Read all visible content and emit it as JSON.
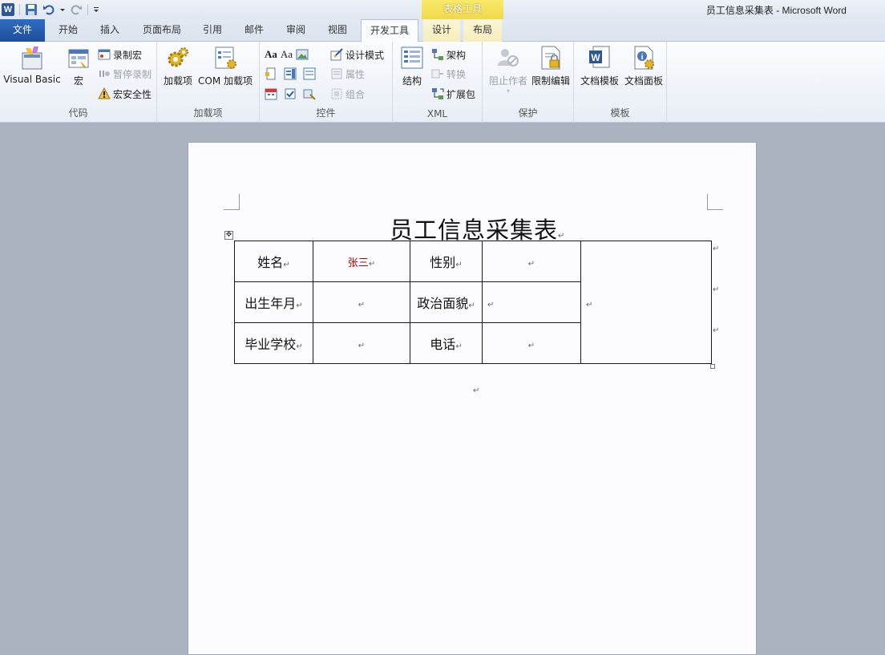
{
  "window": {
    "title": "员工信息采集表 - Microsoft Word",
    "context_tab_group": "表格工具",
    "app_icon_letter": "W"
  },
  "tabs": [
    {
      "label": "文件"
    },
    {
      "label": "开始"
    },
    {
      "label": "插入"
    },
    {
      "label": "页面布局"
    },
    {
      "label": "引用"
    },
    {
      "label": "邮件"
    },
    {
      "label": "审阅"
    },
    {
      "label": "视图"
    },
    {
      "label": "开发工具"
    },
    {
      "label": "设计"
    },
    {
      "label": "布局"
    }
  ],
  "ribbon": {
    "code": {
      "label": "代码",
      "visual_basic": "Visual Basic",
      "macros": "宏",
      "record_macro": "录制宏",
      "pause_recording": "暂停录制",
      "macro_security": "宏安全性"
    },
    "addins": {
      "label": "加载项",
      "addins": "加载项",
      "com_addins": "COM 加载项"
    },
    "controls": {
      "label": "控件",
      "aa1": "Aa",
      "aa2": "Aa",
      "design_mode": "设计模式",
      "properties": "属性",
      "group": "组合"
    },
    "xml": {
      "label": "XML",
      "structure": "结构",
      "schema": "架构",
      "transform": "转换",
      "expansion_packs": "扩展包"
    },
    "protect": {
      "label": "保护",
      "block_authors": "阻止作者",
      "restrict_editing": "限制编辑"
    },
    "templates": {
      "label": "模板",
      "document_template": "文档模板",
      "document_panel": "文档面板"
    }
  },
  "document": {
    "title": "员工信息采集表",
    "paragraph_mark": "↵",
    "table": [
      [
        {
          "text": "姓名"
        },
        {
          "text": "张三",
          "highlight": true
        },
        {
          "text": "性别"
        },
        {
          "text": ""
        }
      ],
      [
        {
          "text": "出生年月"
        },
        {
          "text": ""
        },
        {
          "text": "政治面貌"
        },
        {
          "text": ""
        }
      ],
      [
        {
          "text": "毕业学校"
        },
        {
          "text": ""
        },
        {
          "text": "电话"
        },
        {
          "text": ""
        }
      ]
    ]
  },
  "colors": {
    "file_tab": "#1d4e99",
    "context_tab": "#f1d84a",
    "highlight_text": "#c00000"
  }
}
